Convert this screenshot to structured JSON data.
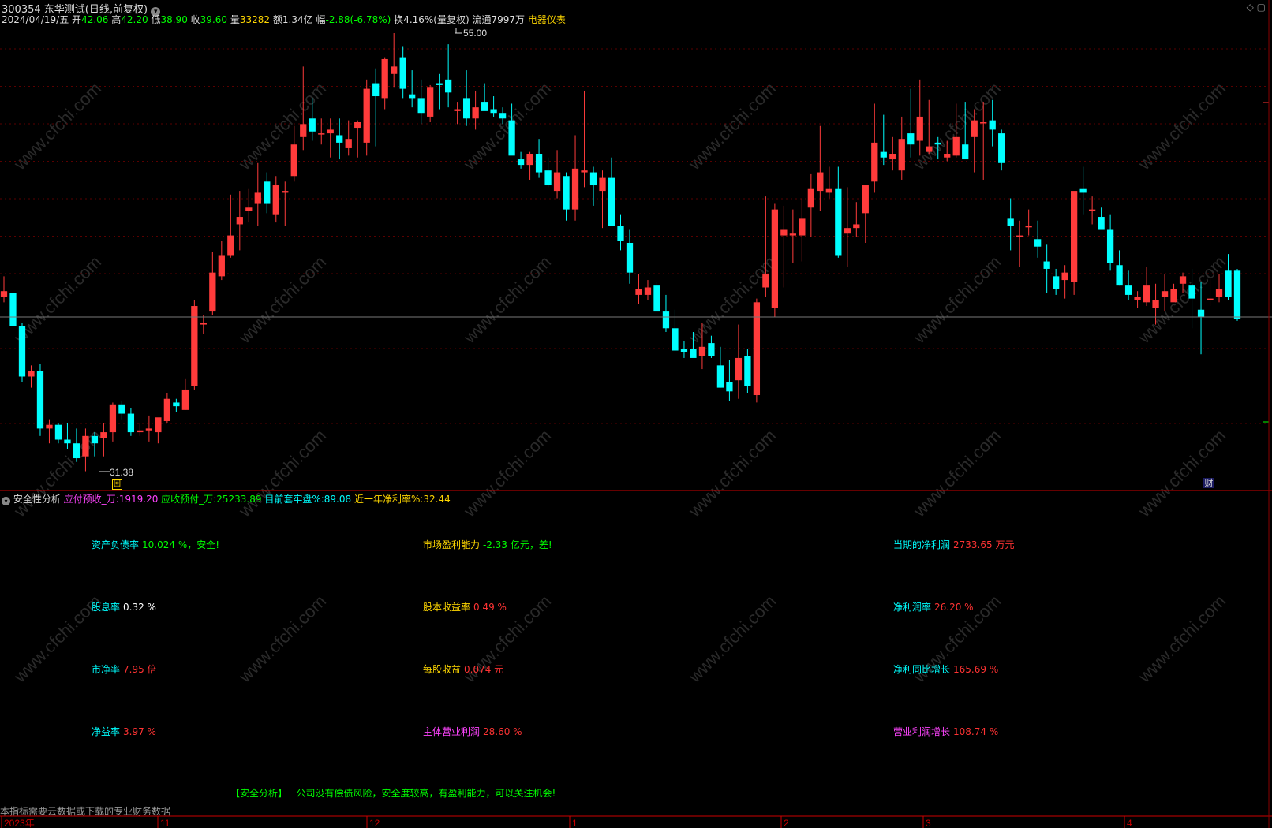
{
  "header": {
    "code": "300354",
    "name": "东华测试",
    "mode": "(日线,前复权)",
    "date": "2024/04/19/五",
    "open_label": "开",
    "open": "42.06",
    "high_label": "高",
    "high": "42.20",
    "low_label": "低",
    "low": "38.90",
    "close_label": "收",
    "close": "39.60",
    "vol_label": "量",
    "vol": "33282",
    "amt_label": "额",
    "amt": "1.34亿",
    "chg_label": "幅",
    "chg": "-2.88(-6.78%)",
    "turn": "换4.16%(量复权)",
    "float": "流通7997万",
    "industry": "电器仪表"
  },
  "price_marks": {
    "high": "55.00",
    "low": "31.38",
    "event": "回",
    "fin_marker": "财"
  },
  "indicator": {
    "name": "安全性分析",
    "v1_label": "应付预收_万:",
    "v1": "1919.20",
    "v2_label": "应收预付_万:",
    "v2": "25233.89",
    "v3_label": "目前套牢盘%:",
    "v3": "89.08",
    "v4_label": "近一年净利率%:",
    "v4": "32.44"
  },
  "financials": {
    "c1": [
      {
        "label": "资产负债率",
        "value": "10.024 %，安全!"
      },
      {
        "label": "股息率",
        "value": "0.32 %"
      },
      {
        "label": "市净率",
        "value": "7.95 倍"
      },
      {
        "label": "净益率",
        "value": "3.97 %"
      }
    ],
    "c2": [
      {
        "label": "市场盈利能力",
        "value": "-2.33 亿元，差!"
      },
      {
        "label": "股本收益率",
        "value": "0.49 %"
      },
      {
        "label": "每股收益",
        "value": "0.074 元"
      },
      {
        "label": "主体营业利润",
        "value": "28.60 %"
      }
    ],
    "c3": [
      {
        "label": "当期的净利润",
        "value": "2733.65 万元"
      },
      {
        "label": "净利润率",
        "value": "26.20 %"
      },
      {
        "label": "净利同比增长",
        "value": "165.69 %"
      },
      {
        "label": "营业利润增长",
        "value": "108.74 %"
      }
    ]
  },
  "analysis": {
    "title": "【安全分析】",
    "text": "公司没有偿债风险，安全度较高，有盈利能力，可以关注机会!"
  },
  "footer_note": "本指标需要云数据或下载的专业财务数据",
  "time_axis": [
    "2023年",
    "11",
    "12",
    "1",
    "2",
    "3",
    "4"
  ],
  "watermark": "www.cfchi.com",
  "colors": {
    "up": "#ff3b3b",
    "down": "#00ffff",
    "grid": "#5a0000",
    "bg": "#000000",
    "accent": "#ffd700"
  },
  "candles": [
    [
      40.8,
      41.9,
      40.5,
      41.1
    ],
    [
      41.0,
      41.2,
      38.9,
      39.2
    ],
    [
      39.2,
      39.4,
      36.2,
      36.5
    ],
    [
      36.5,
      37.1,
      35.9,
      36.8
    ],
    [
      36.8,
      37.2,
      33.3,
      33.7
    ],
    [
      33.7,
      34.2,
      32.9,
      33.9
    ],
    [
      33.9,
      34.0,
      32.9,
      33.1
    ],
    [
      33.1,
      34.0,
      32.6,
      32.9
    ],
    [
      32.9,
      33.7,
      31.9,
      32.1
    ],
    [
      32.2,
      33.7,
      31.4,
      33.3
    ],
    [
      33.3,
      33.5,
      32.2,
      32.9
    ],
    [
      33.2,
      34.0,
      32.2,
      33.5
    ],
    [
      33.5,
      35.1,
      33.0,
      35.0
    ],
    [
      35.0,
      35.2,
      34.2,
      34.5
    ],
    [
      34.5,
      34.8,
      33.3,
      33.5
    ],
    [
      33.5,
      34.0,
      33.3,
      33.6
    ],
    [
      33.6,
      34.4,
      33.0,
      33.7
    ],
    [
      33.5,
      34.0,
      32.9,
      34.3
    ],
    [
      34.1,
      35.6,
      34.0,
      35.3
    ],
    [
      35.1,
      35.3,
      34.6,
      34.9
    ],
    [
      34.7,
      36.4,
      34.7,
      35.8
    ],
    [
      36.0,
      40.6,
      35.8,
      40.3
    ],
    [
      39.3,
      39.8,
      38.8,
      39.4
    ],
    [
      40.0,
      43.2,
      39.8,
      42.1
    ],
    [
      41.9,
      43.8,
      41.7,
      43.0
    ],
    [
      43.0,
      46.3,
      42.9,
      44.1
    ],
    [
      44.7,
      46.5,
      43.3,
      45.1
    ],
    [
      45.4,
      46.6,
      44.8,
      45.6
    ],
    [
      45.8,
      48.0,
      44.6,
      46.4
    ],
    [
      47.0,
      47.5,
      45.3,
      45.8
    ],
    [
      45.2,
      47.3,
      44.8,
      46.8
    ],
    [
      46.4,
      47.0,
      44.6,
      46.5
    ],
    [
      47.3,
      50.0,
      47.0,
      49.0
    ],
    [
      49.4,
      53.2,
      48.7,
      50.1
    ],
    [
      50.4,
      51.5,
      49.2,
      49.7
    ],
    [
      49.6,
      50.4,
      49.0,
      49.6
    ],
    [
      49.6,
      50.4,
      48.3,
      49.8
    ],
    [
      49.5,
      50.4,
      48.2,
      49.1
    ],
    [
      48.8,
      50.3,
      48.4,
      49.3
    ],
    [
      49.9,
      50.3,
      48.3,
      50.2
    ],
    [
      49.1,
      52.5,
      48.4,
      52.0
    ],
    [
      52.3,
      53.1,
      48.9,
      51.6
    ],
    [
      51.5,
      53.7,
      50.9,
      53.6
    ],
    [
      52.8,
      55.0,
      52.1,
      53.2
    ],
    [
      53.7,
      54.3,
      51.5,
      52.0
    ],
    [
      51.7,
      53.0,
      51.0,
      51.5
    ],
    [
      51.5,
      52.5,
      50.1,
      50.7
    ],
    [
      50.5,
      52.2,
      50.2,
      52.1
    ],
    [
      52.3,
      52.8,
      50.9,
      52.2
    ],
    [
      52.5,
      54.4,
      51.0,
      51.8
    ],
    [
      50.8,
      51.3,
      50.1,
      50.9
    ],
    [
      51.5,
      53.0,
      50.0,
      50.4
    ],
    [
      50.4,
      51.9,
      49.8,
      51.0
    ],
    [
      51.3,
      52.3,
      50.9,
      50.8
    ],
    [
      50.9,
      51.6,
      50.5,
      50.7
    ],
    [
      50.7,
      51.0,
      50.1,
      50.4
    ],
    [
      50.3,
      51.2,
      48.7,
      48.4
    ],
    [
      48.2,
      48.6,
      47.7,
      47.9
    ],
    [
      47.9,
      48.6,
      47.1,
      48.5
    ],
    [
      48.5,
      49.3,
      47.2,
      47.5
    ],
    [
      47.6,
      48.3,
      46.7,
      46.8
    ],
    [
      46.5,
      48.7,
      46.1,
      47.5
    ],
    [
      47.3,
      47.5,
      44.9,
      45.5
    ],
    [
      45.5,
      49.5,
      44.9,
      47.7
    ],
    [
      47.5,
      51.9,
      46.7,
      47.6
    ],
    [
      47.5,
      47.8,
      45.7,
      46.8
    ],
    [
      46.5,
      47.6,
      44.5,
      47.2
    ],
    [
      47.2,
      48.3,
      45.3,
      44.6
    ],
    [
      44.6,
      45.2,
      43.3,
      43.8
    ],
    [
      43.7,
      44.4,
      41.5,
      42.1
    ],
    [
      40.9,
      42.0,
      40.4,
      41.2
    ],
    [
      40.9,
      41.7,
      40.6,
      41.3
    ],
    [
      41.4,
      41.6,
      40.1,
      40.0
    ],
    [
      40.0,
      40.9,
      38.9,
      39.1
    ],
    [
      39.1,
      40.1,
      37.9,
      37.9
    ],
    [
      38.0,
      38.4,
      37.5,
      37.8
    ],
    [
      38.0,
      38.9,
      37.6,
      37.5
    ],
    [
      37.6,
      39.4,
      36.9,
      38.1
    ],
    [
      38.3,
      38.7,
      37.5,
      37.6
    ],
    [
      37.1,
      38.1,
      35.9,
      35.9
    ],
    [
      36.2,
      37.4,
      35.2,
      35.7
    ],
    [
      36.3,
      39.3,
      35.3,
      37.5
    ],
    [
      37.6,
      38.0,
      35.6,
      36.0
    ],
    [
      35.5,
      40.7,
      35.1,
      40.5
    ],
    [
      41.3,
      46.2,
      40.8,
      42.0
    ],
    [
      40.2,
      45.8,
      39.7,
      45.5
    ],
    [
      44.1,
      45.7,
      41.3,
      44.4
    ],
    [
      44.1,
      45.5,
      42.6,
      44.2
    ],
    [
      44.1,
      46.1,
      42.7,
      45.0
    ],
    [
      45.6,
      47.4,
      44.0,
      46.6
    ],
    [
      46.5,
      50.0,
      45.4,
      47.5
    ],
    [
      46.4,
      47.8,
      46.1,
      46.6
    ],
    [
      46.6,
      47.8,
      42.9,
      43.0
    ],
    [
      44.2,
      46.7,
      42.4,
      44.5
    ],
    [
      44.5,
      45.9,
      44.0,
      44.7
    ],
    [
      45.3,
      46.8,
      43.7,
      46.8
    ],
    [
      47.0,
      51.2,
      46.4,
      49.1
    ],
    [
      48.6,
      50.6,
      47.9,
      48.3
    ],
    [
      48.2,
      49.4,
      47.6,
      48.5
    ],
    [
      47.6,
      50.5,
      47.1,
      49.3
    ],
    [
      49.6,
      52.0,
      48.3,
      49.0
    ],
    [
      49.2,
      52.5,
      48.4,
      50.5
    ],
    [
      48.6,
      51.4,
      48.5,
      48.9
    ],
    [
      49.1,
      49.4,
      48.2,
      49.0
    ],
    [
      48.3,
      49.2,
      48.1,
      48.5
    ],
    [
      48.4,
      51.2,
      48.3,
      49.4
    ],
    [
      49.0,
      51.3,
      48.9,
      48.2
    ],
    [
      49.4,
      50.9,
      47.5,
      50.3
    ],
    [
      50.2,
      51.3,
      47.1,
      50.2
    ],
    [
      50.3,
      51.4,
      48.9,
      49.8
    ],
    [
      49.6,
      49.8,
      47.6,
      48.0
    ],
    [
      45.0,
      46.1,
      43.3,
      44.6
    ],
    [
      44.0,
      44.9,
      42.4,
      44.1
    ],
    [
      44.6,
      45.5,
      44.1,
      44.6
    ],
    [
      43.9,
      44.9,
      42.9,
      43.5
    ],
    [
      42.7,
      43.6,
      41.0,
      42.3
    ],
    [
      41.9,
      42.3,
      40.9,
      41.2
    ],
    [
      41.7,
      42.5,
      40.7,
      42.1
    ],
    [
      41.6,
      44.6,
      40.9,
      46.5
    ],
    [
      46.6,
      47.8,
      45.2,
      46.4
    ],
    [
      45.4,
      46.2,
      44.7,
      45.5
    ],
    [
      45.1,
      45.6,
      44.4,
      44.4
    ],
    [
      44.4,
      45.2,
      42.2,
      42.6
    ],
    [
      42.5,
      43.3,
      41.4,
      41.4
    ],
    [
      41.4,
      42.2,
      40.6,
      40.9
    ],
    [
      40.6,
      41.1,
      40.2,
      40.8
    ],
    [
      40.5,
      42.4,
      40.3,
      41.4
    ],
    [
      40.2,
      41.5,
      39.3,
      40.6
    ],
    [
      40.8,
      42.0,
      40.0,
      41.1
    ],
    [
      40.5,
      41.5,
      40.8,
      41.2
    ],
    [
      41.5,
      42.1,
      41.0,
      41.9
    ],
    [
      41.4,
      42.3,
      39.1,
      40.7
    ],
    [
      40.1,
      41.6,
      37.7,
      39.7
    ],
    [
      40.6,
      41.8,
      40.3,
      40.7
    ],
    [
      40.8,
      42.0,
      40.5,
      41.2
    ],
    [
      42.2,
      43.1,
      40.6,
      40.8
    ],
    [
      42.2,
      42.3,
      39.5,
      39.6
    ]
  ]
}
